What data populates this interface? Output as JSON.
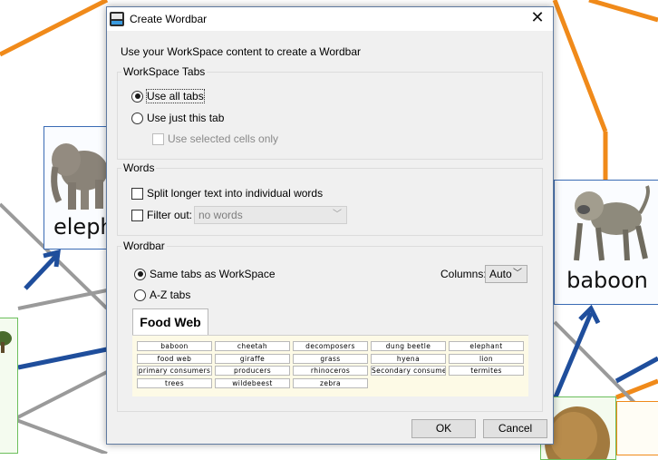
{
  "background": {
    "cards": [
      {
        "name": "elephant",
        "label": "eleph"
      },
      {
        "name": "baboon",
        "label": "baboon"
      }
    ],
    "colors": {
      "orange_link": "#f08a1a",
      "blue_link": "#1f4e9c",
      "gray_link": "#9a9a9a",
      "card_border": "#3a6bb5"
    }
  },
  "dialog": {
    "title": "Create Wordbar",
    "app_icon": "app-icon",
    "close_icon": "close-icon",
    "intro": "Use your WorkSpace content to create a Wordbar",
    "workspace_tabs": {
      "legend": "WorkSpace Tabs",
      "use_all_tabs": "Use all tabs",
      "use_all_tabs_selected": true,
      "use_just_this_tab": "Use just this tab",
      "use_selected_cells_only": "Use selected cells only"
    },
    "words": {
      "legend": "Words",
      "split_longer_text": "Split longer text into individual words",
      "filter_out": "Filter out:",
      "filter_value": "no words"
    },
    "wordbar": {
      "legend": "Wordbar",
      "same_tabs": "Same tabs as WorkSpace",
      "same_tabs_selected": true,
      "az_tabs": "A-Z tabs",
      "columns_label": "Columns:",
      "columns_value": "Auto",
      "tab_name": "Food Web",
      "cells": [
        [
          "baboon",
          "cheetah",
          "decomposers",
          "dung beetle",
          "elephant"
        ],
        [
          "food web",
          "giraffe",
          "grass",
          "hyena",
          "lion"
        ],
        [
          "primary consumers",
          "producers",
          "rhinoceros",
          "Secondary consumers",
          "termites"
        ],
        [
          "trees",
          "wildebeest",
          "zebra"
        ]
      ]
    },
    "ok": "OK",
    "cancel": "Cancel"
  }
}
